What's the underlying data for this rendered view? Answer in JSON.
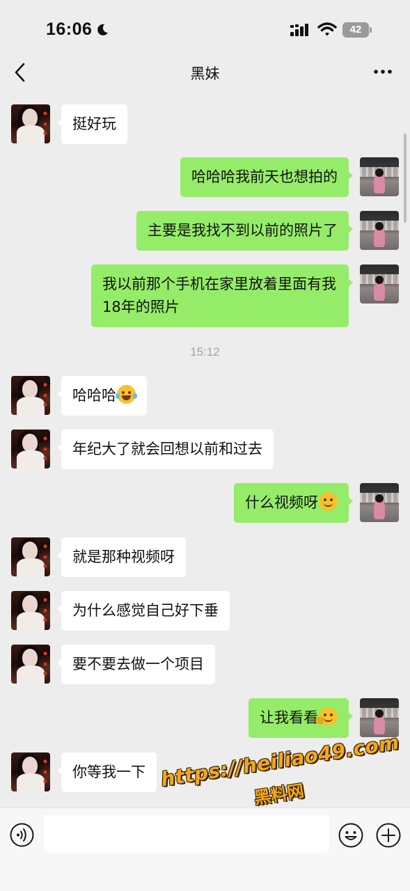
{
  "status_bar": {
    "time": "16:06",
    "battery": "42",
    "icons": [
      "moon-icon",
      "signal-icon",
      "wifi-icon",
      "battery-icon"
    ]
  },
  "header": {
    "title": "黑妹",
    "back_icon": "chevron-left-icon",
    "more_icon": "more-icon"
  },
  "messages": [
    {
      "side": "left",
      "text": "挺好玩"
    },
    {
      "side": "right",
      "text": "哈哈哈我前天也想拍的"
    },
    {
      "side": "right",
      "text": "主要是我找不到以前的照片了"
    },
    {
      "side": "right",
      "text": "我以前那个手机在家里放着里面有我18年的照片"
    },
    {
      "type": "timestamp",
      "text": "15:12"
    },
    {
      "side": "left",
      "text": "哈哈哈",
      "emoji": "laughing-tears-emoji"
    },
    {
      "side": "left",
      "text": "年纪大了就会回想以前和过去"
    },
    {
      "side": "right",
      "text": "什么视频呀",
      "emoji": "smile-emoji"
    },
    {
      "side": "left",
      "text": "就是那种视频呀"
    },
    {
      "side": "left",
      "text": "为什么感觉自己好下垂"
    },
    {
      "side": "left",
      "text": "要不要去做一个项目"
    },
    {
      "side": "right",
      "text": "让我看看",
      "emoji": "wink-emoji"
    },
    {
      "side": "left",
      "text": "你等我一下"
    }
  ],
  "input_bar": {
    "placeholder": "",
    "icons": [
      "voice-icon",
      "emoji-icon",
      "plus-icon"
    ]
  },
  "watermark": {
    "url": "https://heiliao49.com",
    "name": "黑料网"
  },
  "colors": {
    "background": "#ededed",
    "sent_bubble": "#95ec69",
    "received_bubble": "#ffffff",
    "timestamp": "#a3a3a3",
    "watermark": "#f2a81f"
  }
}
